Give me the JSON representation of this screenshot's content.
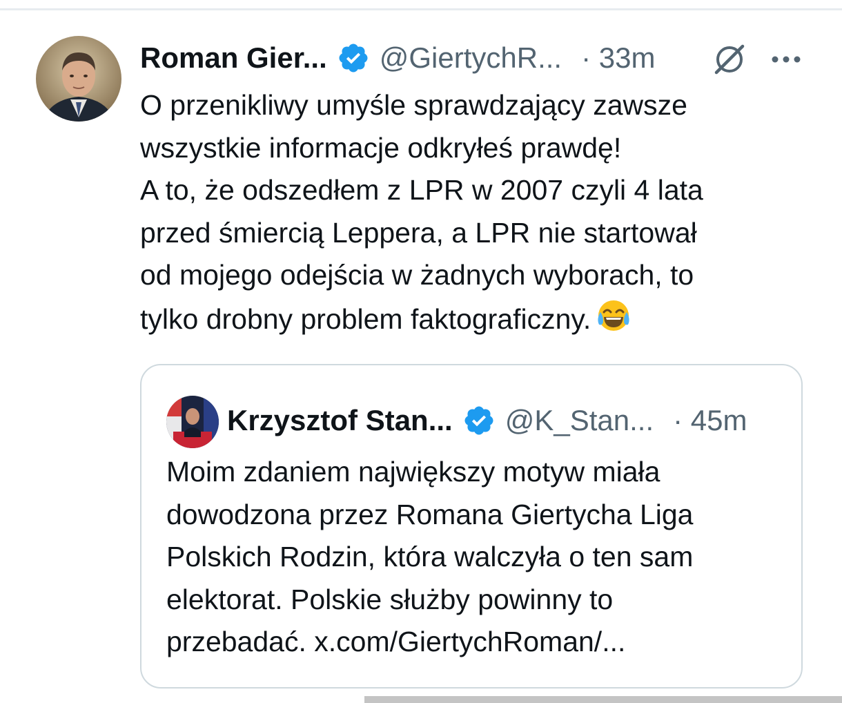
{
  "tweet": {
    "author_name": "Roman Gier...",
    "handle": "@GiertychR...",
    "time": "· 33m",
    "icons": {
      "verified": "verified-badge-icon",
      "grok": "grok-icon",
      "more": "more-options-icon",
      "emoji": "face-with-tears-of-joy-emoji"
    },
    "body_lines": [
      "O przenikliwy umyśle sprawdzający zawsze",
      "wszystkie informacje odkryłeś prawdę!",
      "A to, że odszedłem z LPR w 2007 czyli 4 lata",
      "przed śmiercią Leppera, a LPR nie startował",
      "od mojego odejścia w żadnych wyborach, to",
      "tylko drobny problem faktograficzny."
    ]
  },
  "quoted_tweet": {
    "author_name": "Krzysztof Stan...",
    "handle": "@K_Stan...",
    "time": "· 45m",
    "body_lines": [
      "Moim zdaniem największy motyw miała",
      "dowodzona przez Romana Giertycha Liga",
      "Polskich Rodzin, która walczyła o ten sam",
      "elektorat. Polskie służby powinny to",
      "przebadać. x.com/GiertychRoman/..."
    ]
  },
  "colors": {
    "text_primary": "#0f1419",
    "text_secondary": "#536471",
    "verified_blue": "#1d9bf0",
    "card_border": "#cfd9de"
  }
}
